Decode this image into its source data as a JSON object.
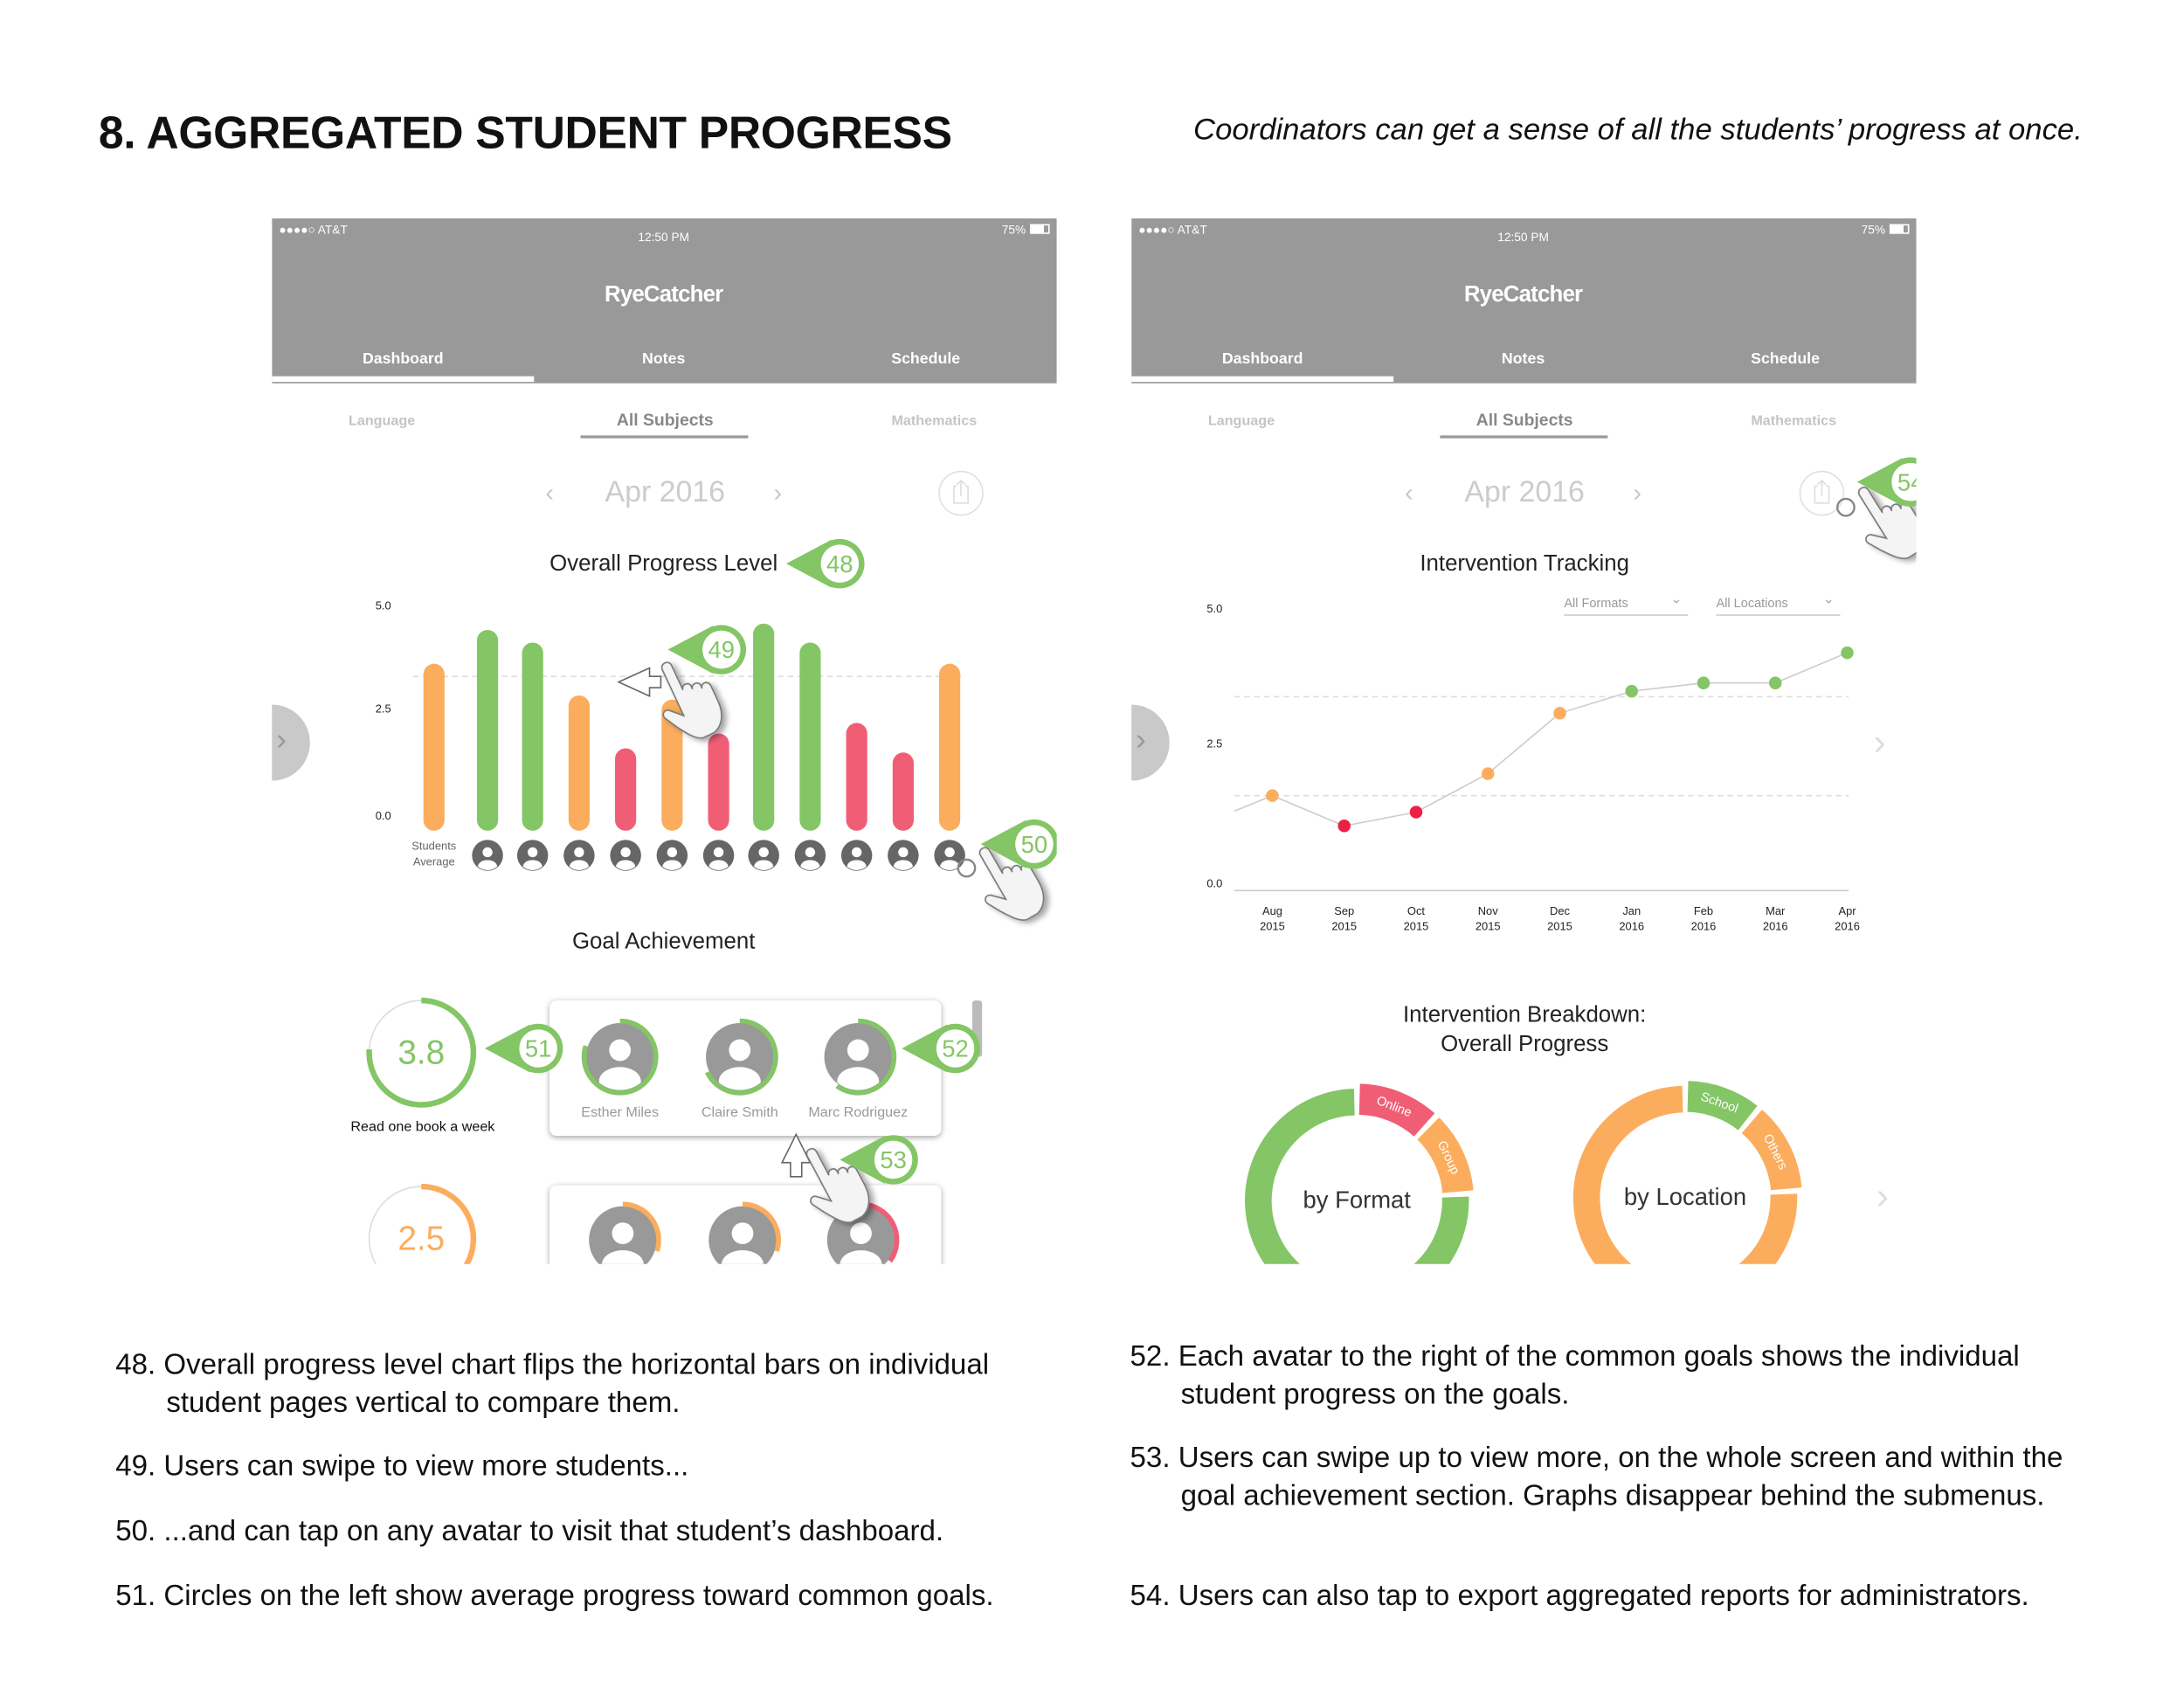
{
  "page": {
    "title": "8. AGGREGATED STUDENT PROGRESS",
    "subtitle": "Coordinators can get a sense of all the students’ progress at once."
  },
  "colors": {
    "green": "#84c566",
    "orange": "#fbad5d",
    "red": "#f05e76",
    "point_red": "#ec2046",
    "header_gray": "#999999",
    "avatar_gray": "#666666"
  },
  "app": {
    "status": {
      "carrier": "●●●●○ AT&T",
      "time": "12:50 PM",
      "battery": "75%"
    },
    "logo": "RyeCatcher",
    "tabs": [
      "Dashboard",
      "Notes",
      "Schedule"
    ],
    "active_tab": "Dashboard",
    "subtabs": [
      "Language",
      "All Subjects",
      "Mathematics"
    ],
    "active_subtab": "All Subjects",
    "month": "Apr 2016",
    "icons": {
      "prev": "chevron-left-icon",
      "next": "chevron-right-icon",
      "export": "share-export-icon",
      "wifi": "wifi-icon",
      "bluetooth": "bluetooth-icon",
      "battery": "battery-icon"
    }
  },
  "left_screen": {
    "progress_title": "Overall Progress Level",
    "avg_label_1": "Students",
    "avg_label_2": "Average",
    "goal_title": "Goal Achievement",
    "goals": [
      {
        "value": "3.8",
        "label": "Read one book a week",
        "color": "#84c566",
        "students": [
          {
            "name": "Esther Miles",
            "progress": 0.8,
            "color": "#84c566"
          },
          {
            "name": "Claire Smith",
            "progress": 0.68,
            "color": "#84c566"
          },
          {
            "name": "Marc Rodriguez",
            "progress": 0.6,
            "color": "#84c566"
          }
        ]
      },
      {
        "value": "2.5",
        "label": "",
        "color": "#fbad5d",
        "students": [
          {
            "name": "",
            "progress": 0.3,
            "color": "#fbad5d"
          },
          {
            "name": "",
            "progress": 0.3,
            "color": "#fbad5d"
          },
          {
            "name": "",
            "progress": 0.35,
            "color": "#f05e76"
          }
        ]
      }
    ]
  },
  "right_screen": {
    "tracking_title": "Intervention Tracking",
    "filters": [
      "All Formats",
      "All Locations"
    ],
    "breakdown_title_1": "Intervention Breakdown:",
    "breakdown_title_2": "Overall Progress"
  },
  "callouts": [
    "48",
    "49",
    "50",
    "51",
    "52",
    "53",
    "54"
  ],
  "chart_data": [
    {
      "type": "bar",
      "title": "Overall Progress Level",
      "categories": [
        "Students Average",
        "Student 1",
        "Student 2",
        "Student 3",
        "Student 4",
        "Student 5",
        "Student 6",
        "Student 7",
        "Student 8",
        "Student 9",
        "Student 10",
        "Student 11"
      ],
      "values": [
        3.45,
        4.25,
        3.95,
        2.7,
        1.45,
        2.6,
        1.8,
        4.4,
        3.95,
        2.05,
        1.35,
        3.45
      ],
      "colors": [
        "#fbad5d",
        "#84c566",
        "#84c566",
        "#fbad5d",
        "#f05e76",
        "#fbad5d",
        "#f05e76",
        "#84c566",
        "#84c566",
        "#f05e76",
        "#f05e76",
        "#fbad5d"
      ],
      "yticks": [
        "0.0",
        "2.5",
        "5.0"
      ],
      "ylim": [
        0,
        5
      ],
      "reference_line": 3.4
    },
    {
      "type": "line",
      "title": "Intervention Tracking",
      "x": [
        [
          "Aug",
          "2015"
        ],
        [
          "Sep",
          "2015"
        ],
        [
          "Oct",
          "2015"
        ],
        [
          "Nov",
          "2015"
        ],
        [
          "Dec",
          "2015"
        ],
        [
          "Jan",
          "2016"
        ],
        [
          "Feb",
          "2016"
        ],
        [
          "Mar",
          "2016"
        ],
        [
          "Apr",
          "2016"
        ]
      ],
      "values": [
        1.6,
        1.05,
        1.3,
        2.0,
        3.1,
        3.5,
        3.65,
        3.65,
        4.2
      ],
      "colors": [
        "#fbad5d",
        "#ec2046",
        "#ec2046",
        "#fbad5d",
        "#fbad5d",
        "#84c566",
        "#84c566",
        "#84c566",
        "#84c566"
      ],
      "yticks": [
        "0.0",
        "2.5",
        "5.0"
      ],
      "ylim": [
        0,
        5
      ],
      "reference_lines": [
        1.6,
        3.4
      ]
    },
    {
      "type": "pie",
      "center_label": "by Format",
      "segments": [
        {
          "label": "Online",
          "fraction": 0.12,
          "color": "#f05e76"
        },
        {
          "label": "Group",
          "fraction": 0.12,
          "color": "#fbad5d"
        },
        {
          "label": "",
          "fraction": 0.76,
          "color": "#84c566"
        }
      ]
    },
    {
      "type": "pie",
      "center_label": "by Location",
      "segments": [
        {
          "label": "School",
          "fraction": 0.11,
          "color": "#84c566"
        },
        {
          "label": "Others",
          "fraction": 0.13,
          "color": "#fbad5d"
        },
        {
          "label": "",
          "fraction": 0.76,
          "color": "#fbad5d"
        }
      ]
    }
  ],
  "notes": [
    "48. Overall progress level chart flips the horizontal bars on individual student pages vertical to compare them.",
    "49. Users can swipe to view more students...",
    "50. ...and can tap on any avatar to visit that student’s dashboard.",
    "51. Circles on the left show average progress toward common goals.",
    "52. Each avatar to the right of the common goals shows the individual student progress on the goals.",
    "53. Users can swipe up to view more, on the whole screen and within the goal achievement section. Graphs disappear behind the submenus.",
    "54. Users can also tap to export aggregated reports for administrators."
  ]
}
